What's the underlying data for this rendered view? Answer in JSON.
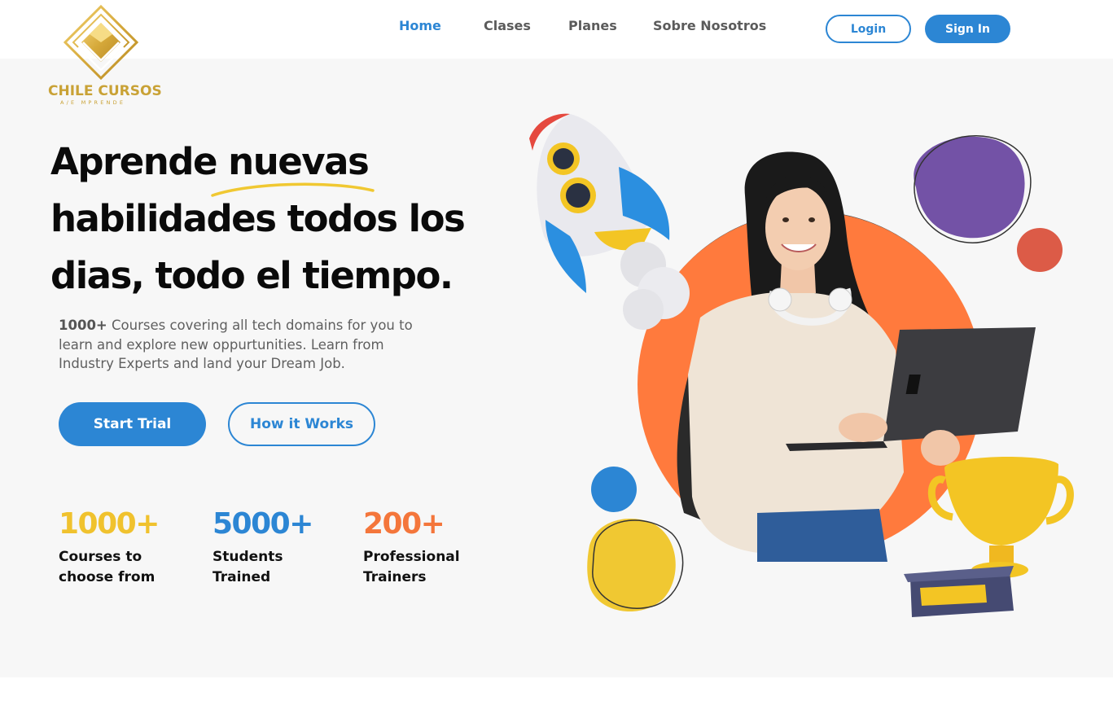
{
  "brand": {
    "name": "CHILE CURSOS",
    "tagline": "A/E MPRENDE",
    "gold": "#c9a236"
  },
  "nav": {
    "items": [
      {
        "label": "Home",
        "active": true
      },
      {
        "label": "Clases",
        "active": false
      },
      {
        "label": "Planes",
        "active": false
      },
      {
        "label": "Sobre Nosotros",
        "active": false
      }
    ],
    "login_label": "Login",
    "signin_label": "Sign In"
  },
  "hero": {
    "headline_line1": "Aprende nuevas",
    "headline_line2": "habilidades todos los",
    "headline_line3": "dias, todo el tiempo.",
    "desc_strong": "1000+",
    "desc_text": " Courses covering all tech domains for you to learn and explore new oppurtunities. Learn from Industry Experts and land your Dream Job.",
    "primary_cta": "Start Trial",
    "secondary_cta": "How it Works"
  },
  "stats": [
    {
      "value": "1000+",
      "label_line1": "Courses to",
      "label_line2": "choose from",
      "color": "#f0c22e"
    },
    {
      "value": "5000+",
      "label_line1": "Students",
      "label_line2": "Trained",
      "color": "#2c86d4"
    },
    {
      "value": "200+",
      "label_line1": "Professional",
      "label_line2": "Trainers",
      "color": "#f4763b"
    }
  ],
  "colors": {
    "accent_blue": "#2c86d4",
    "orange": "#ff7a3d",
    "purple": "#7352a6",
    "yellow": "#f0c832",
    "red": "#dc5b47",
    "hero_bg": "#f7f7f7"
  },
  "icons": [
    "logo-diamond-icon",
    "rocket-icon",
    "trophy-icon",
    "student-photo"
  ]
}
